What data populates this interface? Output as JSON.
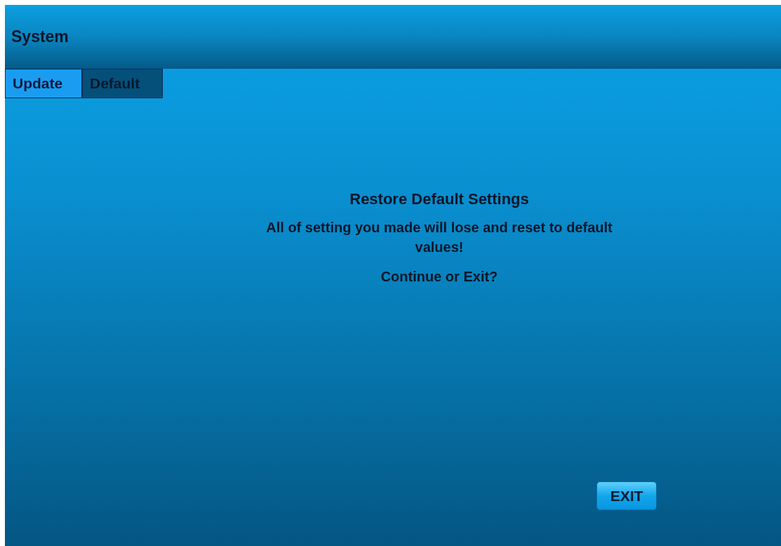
{
  "header": {
    "title": "System"
  },
  "tabs": [
    {
      "label": "Update",
      "selected": false
    },
    {
      "label": "Default",
      "selected": true
    }
  ],
  "message": {
    "title": "Restore Default Settings",
    "body": "All of setting you made will lose and reset to default values!",
    "question": "Continue or Exit?"
  },
  "buttons": [
    {
      "label": "EXIT"
    }
  ]
}
